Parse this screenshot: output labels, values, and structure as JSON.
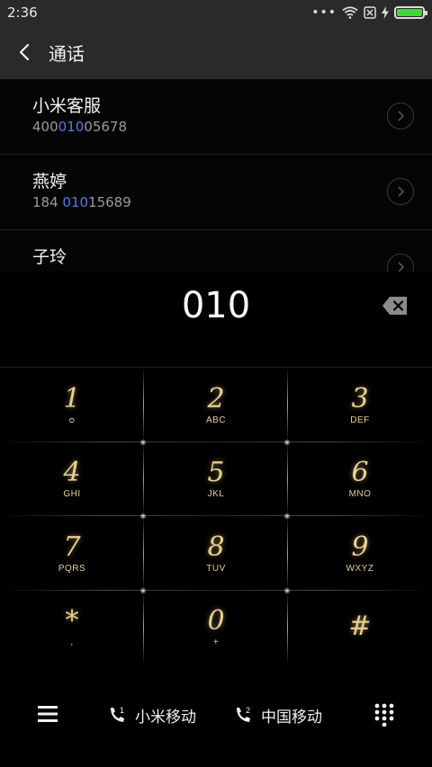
{
  "status_bar": {
    "time": "2:36",
    "dots": "•••",
    "battery_level": 1.0
  },
  "title_bar": {
    "title": "通话"
  },
  "contacts": [
    {
      "name": "小米客服",
      "number_pre": "400",
      "number_hl": "010",
      "number_post": "05678"
    },
    {
      "name": "燕婷",
      "number_pre": "184 ",
      "number_hl": "010",
      "number_post": "15689"
    },
    {
      "name": "子玲",
      "number_pre": "",
      "number_hl": "",
      "number_post": ""
    }
  ],
  "dial": {
    "value": "010"
  },
  "keypad": [
    [
      {
        "digit": "1",
        "letters": "ᴑ"
      },
      {
        "digit": "2",
        "letters": "ABC"
      },
      {
        "digit": "3",
        "letters": "DEF"
      }
    ],
    [
      {
        "digit": "4",
        "letters": "GHI"
      },
      {
        "digit": "5",
        "letters": "JKL"
      },
      {
        "digit": "6",
        "letters": "MNO"
      }
    ],
    [
      {
        "digit": "7",
        "letters": "PQRS"
      },
      {
        "digit": "8",
        "letters": "TUV"
      },
      {
        "digit": "9",
        "letters": "WXYZ"
      }
    ],
    [
      {
        "digit": "*",
        "letters": ","
      },
      {
        "digit": "0",
        "letters": "+"
      },
      {
        "digit": "#",
        "letters": ""
      }
    ]
  ],
  "bottom_bar": {
    "sim1_label": "小米移动",
    "sim1_index": "1",
    "sim2_label": "中国移动",
    "sim2_index": "2"
  },
  "colors": {
    "accent_highlight": "#4f7de8",
    "key_gold": "#e8cf8e",
    "battery_green": "#46d43c"
  },
  "icons": {
    "back": "chevron-left-icon",
    "backspace": "backspace-icon",
    "menu": "hamburger-icon",
    "dialpad": "dialpad-icon",
    "sim_call": "phone-icon"
  }
}
